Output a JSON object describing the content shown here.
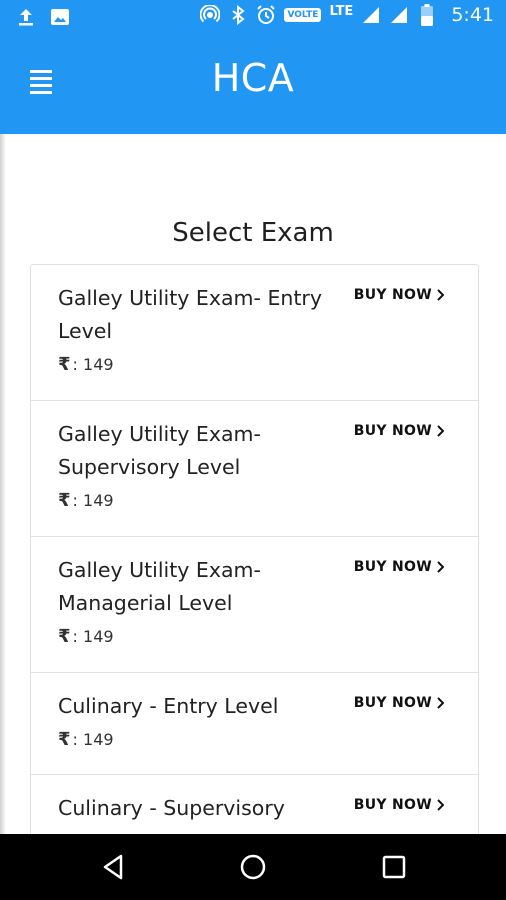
{
  "status_bar": {
    "left_icons": [
      "upload-icon",
      "image-icon"
    ],
    "right_icons": [
      "hotspot-icon",
      "bluetooth-icon",
      "alarm-icon",
      "volte-badge",
      "signal-icon",
      "signal-icon",
      "battery-icon"
    ],
    "volte_label": "VOLTE",
    "network_label": "LTE",
    "time": "5:41"
  },
  "app_bar": {
    "title": "HCA",
    "menu_icon": "menu-icon",
    "color": "#2196f3"
  },
  "main": {
    "section_title": "Select Exam",
    "currency_symbol": "₹",
    "buy_label": "BUY NOW",
    "exams": [
      {
        "name": "Galley Utility Exam- Entry Level",
        "price": ": 149"
      },
      {
        "name": "Galley Utility Exam- Supervisory Level",
        "price": ": 149"
      },
      {
        "name": "Galley Utility Exam- Managerial Level",
        "price": ": 149"
      },
      {
        "name": "Culinary - Entry Level",
        "price": ": 149"
      },
      {
        "name": "Culinary - Supervisory",
        "price": ""
      }
    ]
  },
  "nav_bar": {
    "buttons": [
      "back-icon",
      "home-icon",
      "recents-icon"
    ]
  }
}
